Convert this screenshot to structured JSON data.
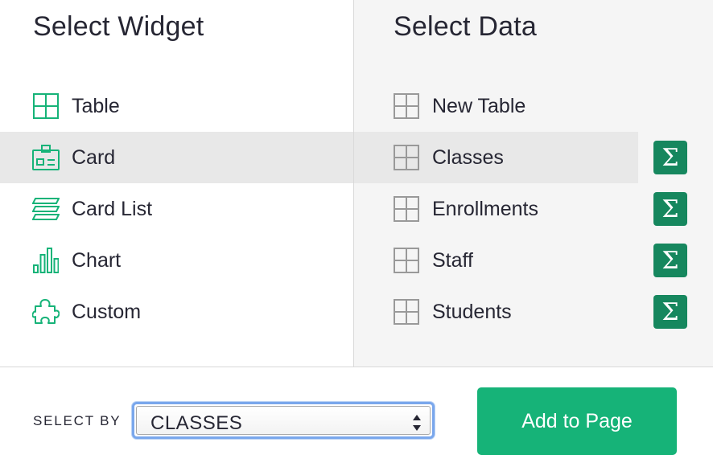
{
  "widgets": {
    "heading": "Select Widget",
    "items": [
      {
        "label": "Table",
        "icon": "table-widget-icon",
        "selected": false
      },
      {
        "label": "Card",
        "icon": "card-widget-icon",
        "selected": true
      },
      {
        "label": "Card List",
        "icon": "card-list-widget-icon",
        "selected": false
      },
      {
        "label": "Chart",
        "icon": "chart-widget-icon",
        "selected": false
      },
      {
        "label": "Custom",
        "icon": "custom-widget-icon",
        "selected": false
      }
    ]
  },
  "data": {
    "heading": "Select Data",
    "items": [
      {
        "label": "New Table",
        "icon": "table-icon",
        "selected": false,
        "summary": false
      },
      {
        "label": "Classes",
        "icon": "table-icon",
        "selected": true,
        "summary": true
      },
      {
        "label": "Enrollments",
        "icon": "table-icon",
        "selected": false,
        "summary": true
      },
      {
        "label": "Staff",
        "icon": "table-icon",
        "selected": false,
        "summary": true
      },
      {
        "label": "Students",
        "icon": "table-icon",
        "selected": false,
        "summary": true
      }
    ],
    "summary_symbol": "Σ"
  },
  "footer": {
    "select_by_label": "SELECT BY",
    "select_by_value": "CLASSES",
    "add_button_label": "Add to Page"
  },
  "colors": {
    "accent": "#16b378",
    "summary_button": "#16875e",
    "widget_icon": "#16b378",
    "data_icon": "#999999",
    "selected_row": "#e8e8e8"
  }
}
